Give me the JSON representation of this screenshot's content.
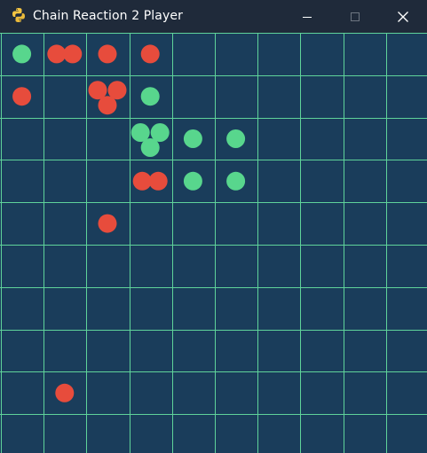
{
  "window": {
    "title": "Chain Reaction 2 Player",
    "controls": [
      "minimize",
      "maximize",
      "close"
    ],
    "app_icon": "python-icon"
  },
  "board": {
    "rows": 10,
    "cols": 10,
    "background": "#1a3d5b",
    "grid_color": "#5fd39a",
    "players": [
      {
        "color": "#e74c3c"
      },
      {
        "color": "#58d68d"
      }
    ],
    "cells": [
      {
        "row": 0,
        "col": 0,
        "player": 2,
        "count": 1
      },
      {
        "row": 0,
        "col": 1,
        "player": 1,
        "count": 2
      },
      {
        "row": 0,
        "col": 2,
        "player": 1,
        "count": 1
      },
      {
        "row": 0,
        "col": 3,
        "player": 1,
        "count": 1
      },
      {
        "row": 1,
        "col": 0,
        "player": 1,
        "count": 1
      },
      {
        "row": 1,
        "col": 2,
        "player": 1,
        "count": 3
      },
      {
        "row": 1,
        "col": 3,
        "player": 2,
        "count": 1
      },
      {
        "row": 2,
        "col": 3,
        "player": 2,
        "count": 3
      },
      {
        "row": 2,
        "col": 4,
        "player": 2,
        "count": 1
      },
      {
        "row": 2,
        "col": 5,
        "player": 2,
        "count": 1
      },
      {
        "row": 3,
        "col": 3,
        "player": 1,
        "count": 2
      },
      {
        "row": 3,
        "col": 4,
        "player": 2,
        "count": 1
      },
      {
        "row": 3,
        "col": 5,
        "player": 2,
        "count": 1
      },
      {
        "row": 4,
        "col": 2,
        "player": 1,
        "count": 1
      },
      {
        "row": 8,
        "col": 1,
        "player": 1,
        "count": 1
      }
    ]
  }
}
